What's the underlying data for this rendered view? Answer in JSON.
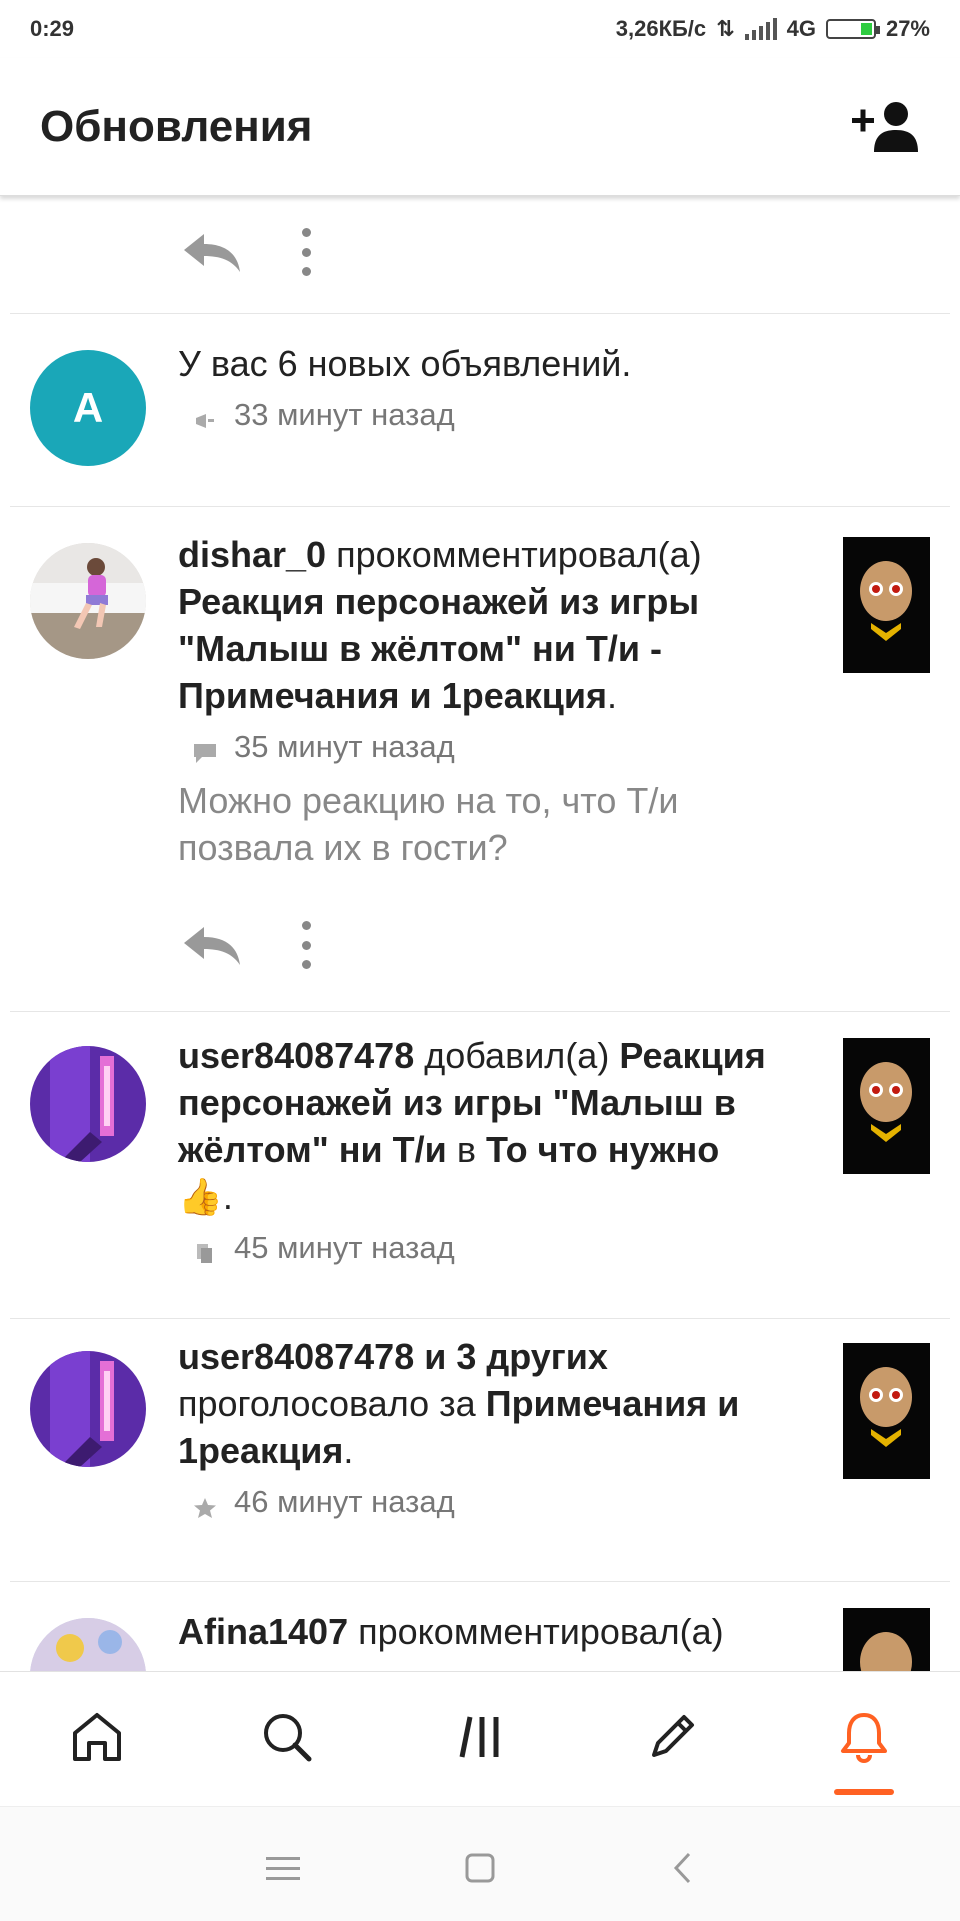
{
  "status_bar": {
    "time": "0:29",
    "speed": "3,26КБ/с",
    "network": "4G",
    "battery": "27%",
    "battery_level": 0.27
  },
  "header": {
    "title": "Обновления",
    "add_contact_icon": "add-person-icon"
  },
  "feed": {
    "announcement": {
      "avatar_letter": "A",
      "avatar_color": "#1aa7b8",
      "text": "У вас 6 новых объявлений.",
      "time": "33 минут назад",
      "icon": "megaphone-icon"
    },
    "items": [
      {
        "user": "dishar_0",
        "action": "прокомментировал(а)",
        "target_1": "Реакция персонажей из игры",
        "target_2": "\"Малыш в жёлтом\" ни Т/и -",
        "target_3": "Примечания и 1реакция",
        "suffix": ".",
        "time": "35 минут назад",
        "icon": "comment-icon",
        "comment_1": "Можно реакцию на то, что Т/и",
        "comment_2": "позвала их в гости?"
      },
      {
        "user": "user84087478",
        "action": "добавил(а)",
        "target_a": "Реакция",
        "target_b": "персонажей из игры \"Малыш в",
        "target_c": "жёлтом\" ни Т/и",
        "connector": "в",
        "list_name": "То что нужно",
        "emoji": "👍",
        "suffix": ".",
        "time": "45 минут назад",
        "icon": "copy-icon"
      },
      {
        "user_group": "user84087478 и 3 других",
        "action": "проголосовало за",
        "target_a": "Примечания и",
        "target_b": "1реакция",
        "suffix": ".",
        "time": "46 минут назад",
        "icon": "star-icon"
      },
      {
        "user": "Afina1407",
        "action": "прокомментировал(а)"
      }
    ]
  },
  "bottom_nav": {
    "items": [
      "home-icon",
      "search-icon",
      "library-icon",
      "write-icon",
      "notifications-icon"
    ],
    "active": "notifications-icon",
    "accent": "#ff6122"
  },
  "system_nav": [
    "menu-icon",
    "home-square-icon",
    "back-icon"
  ]
}
